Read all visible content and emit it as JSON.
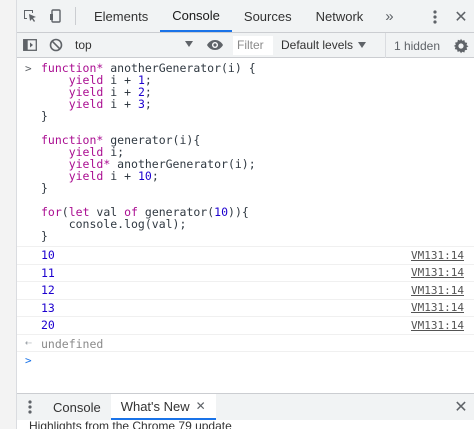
{
  "tabs": {
    "items": [
      "Elements",
      "Console",
      "Sources",
      "Network"
    ],
    "more": "»",
    "close": "✕"
  },
  "toolbar": {
    "context": "top",
    "filter_placeholder": "Filter",
    "levels": "Default levels",
    "hidden": "1 hidden"
  },
  "console": {
    "code_lines": [
      "function* anotherGenerator(i) {",
      "    yield i + 1;",
      "    yield i + 2;",
      "    yield i + 3;",
      "}",
      "",
      "function* generator(i){",
      "    yield i;",
      "    yield* anotherGenerator(i);",
      "    yield i + 10;",
      "}",
      "",
      "for(let val of generator(10)){",
      "    console.log(val);",
      "}"
    ],
    "outputs": [
      {
        "value": "10",
        "source": "VM131:14"
      },
      {
        "value": "11",
        "source": "VM131:14"
      },
      {
        "value": "12",
        "source": "VM131:14"
      },
      {
        "value": "13",
        "source": "VM131:14"
      },
      {
        "value": "20",
        "source": "VM131:14"
      }
    ],
    "result": "undefined"
  },
  "drawer": {
    "tabs": [
      "Console",
      "What's New"
    ],
    "tab_close": "✕",
    "close": "✕",
    "peek": "Highlights from the Chrome 79 update"
  },
  "colors": {
    "accent": "#1a73e8",
    "keyword": "#aa0d91",
    "number": "#1c00cf"
  }
}
